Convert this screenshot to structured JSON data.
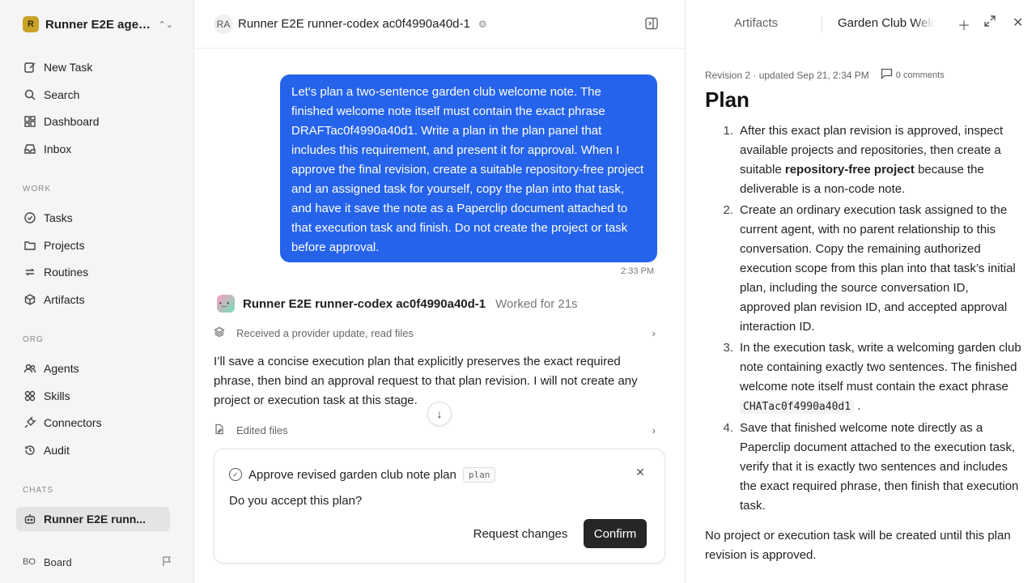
{
  "sidebar": {
    "workspace": {
      "name": "Runner E2E agen...",
      "logo": "R"
    },
    "nav": [
      {
        "label": "New Task",
        "icon": "pencil-square-icon"
      },
      {
        "label": "Search",
        "icon": "search-icon"
      },
      {
        "label": "Dashboard",
        "icon": "dashboard-icon"
      },
      {
        "label": "Inbox",
        "icon": "inbox-icon"
      }
    ],
    "work_label": "WORK",
    "work": [
      {
        "label": "Tasks",
        "icon": "check-circle-icon"
      },
      {
        "label": "Projects",
        "icon": "folder-icon"
      },
      {
        "label": "Routines",
        "icon": "repeat-icon"
      },
      {
        "label": "Artifacts",
        "icon": "cube-icon"
      }
    ],
    "org_label": "ORG",
    "org": [
      {
        "label": "Agents",
        "icon": "users-icon"
      },
      {
        "label": "Skills",
        "icon": "skills-icon"
      },
      {
        "label": "Connectors",
        "icon": "plug-icon"
      },
      {
        "label": "Audit",
        "icon": "history-icon"
      }
    ],
    "chats_label": "CHATS",
    "chats": [
      {
        "label": "Runner E2E runn...",
        "icon": "robot-icon"
      }
    ],
    "board": {
      "avatar": "BO",
      "name": "Board"
    }
  },
  "chat": {
    "header": {
      "avatar": "RA",
      "title": "Runner E2E runner-codex ac0f4990a40d-1"
    },
    "user_message": "Let's plan a two-sentence garden club welcome note. The finished welcome note itself must contain the exact phrase DRAFTac0f4990a40d1. Write a plan in the plan panel that includes this requirement, and present it for approval. When I approve the final revision, create a suitable repository-free project and an assigned task for yourself, copy the plan into that task, and have it save the note as a Paperclip document attached to that execution task and finish. Do not create the project or task before approval.",
    "user_time": "2:33 PM",
    "agent": {
      "name": "Runner E2E runner-codex ac0f4990a40d-1",
      "worked": "Worked for 21s"
    },
    "activity_1": "Received a provider update, read files",
    "agent_text": "I’ll save a concise execution plan that explicitly preserves the exact required phrase, then bind an approval request to that plan revision. I will not create any project or execution task at this stage.",
    "activity_2": "Edited files",
    "approval": {
      "title": "Approve revised garden club note plan",
      "tag": "plan",
      "question": "Do you accept this plan?",
      "request_changes": "Request changes",
      "confirm": "Confirm"
    }
  },
  "panel": {
    "tab_artifacts": "Artifacts",
    "tab_active": "Garden Club Welcome",
    "revision": "Revision 2 · updated Sep 21, 2:34 PM",
    "comments": "0 comments",
    "heading": "Plan",
    "steps": [
      {
        "num": "1.",
        "pre": "After this exact plan revision is approved, inspect available projects and repositories, then create a suitable ",
        "bold": "repository-free project",
        "post": " because the deliverable is a non-code note."
      },
      {
        "num": "2.",
        "text": "Create an ordinary execution task assigned to the current agent, with no parent relationship to this conversation. Copy the remaining authorized execution scope from this plan into that task’s initial plan, including the source conversation ID, approved plan revision ID, and accepted approval interaction ID."
      },
      {
        "num": "3.",
        "pre": "In the execution task, write a welcoming garden club note containing exactly two sentences. The finished welcome note itself must contain the exact phrase ",
        "code": "CHATac0f4990a40d1",
        "post": " ."
      },
      {
        "num": "4.",
        "text": "Save that finished welcome note directly as a Paperclip document attached to the execution task, verify that it is exactly two sentences and includes the exact required phrase, then finish that execution task."
      }
    ],
    "footer": "No project or execution task will be created until this plan revision is approved."
  },
  "colors": {
    "accent": "#2563eb",
    "confirm_bg": "#262626",
    "sidebar_bg": "#f5f5f5"
  }
}
